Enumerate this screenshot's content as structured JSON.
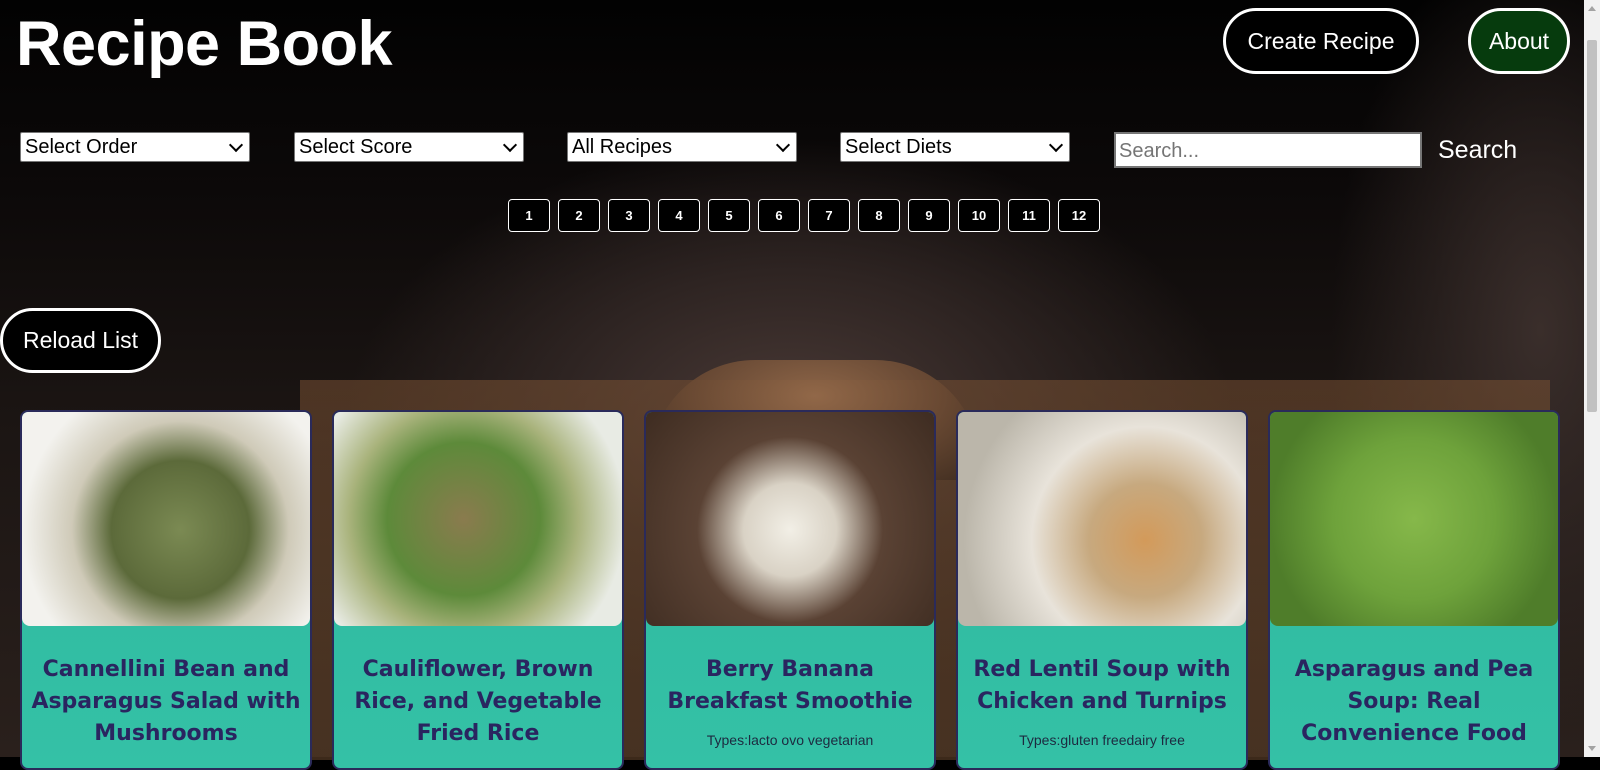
{
  "app_title": "Recipe Book",
  "header": {
    "create_label": "Create Recipe",
    "about_label": "About"
  },
  "filters": {
    "order": "Select Order",
    "score": "Select Score",
    "recipes": "All Recipes",
    "diets": "Select Diets",
    "search_placeholder": "Search...",
    "search_label": "Search"
  },
  "pagination": [
    "1",
    "2",
    "3",
    "4",
    "5",
    "6",
    "7",
    "8",
    "9",
    "10",
    "11",
    "12"
  ],
  "reload_label": "Reload List",
  "recipes": [
    {
      "title": "Cannellini Bean and Asparagus Salad with Mushrooms",
      "types": ""
    },
    {
      "title": "Cauliflower, Brown Rice, and Vegetable Fried Rice",
      "types": ""
    },
    {
      "title": "Berry Banana Breakfast Smoothie",
      "types": "Types:lacto ovo vegetarian"
    },
    {
      "title": "Red Lentil Soup with Chicken and Turnips",
      "types": "Types:gluten freedairy free"
    },
    {
      "title": "Asparagus and Pea Soup: Real Convenience Food",
      "types": ""
    }
  ],
  "colors": {
    "about_bg": "#063b0d",
    "card_bg": "#2fb79e",
    "card_title": "#2a2560"
  }
}
